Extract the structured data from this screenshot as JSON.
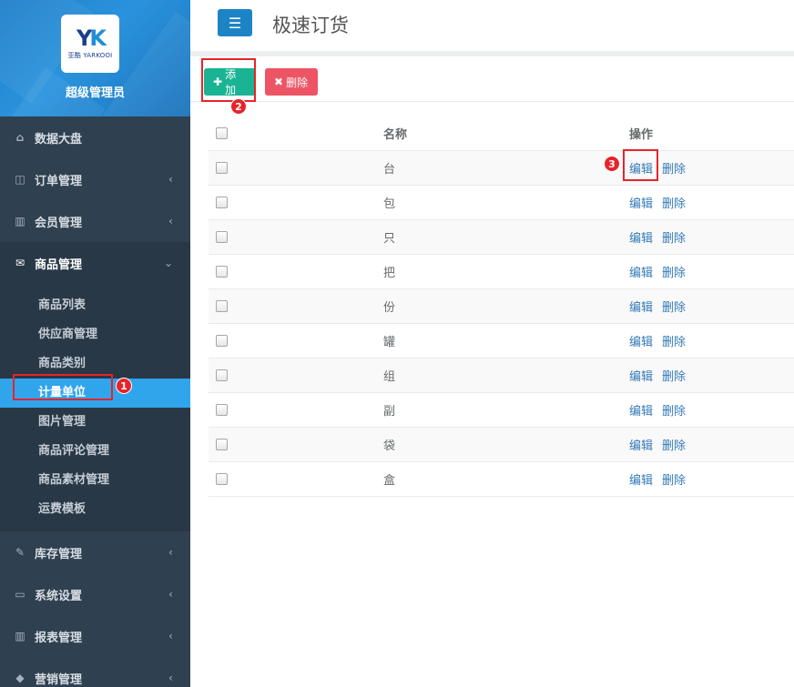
{
  "brand": {
    "logo_mark": "YK",
    "logo_text": "亚酷 YARKOOI",
    "user_role": "超级管理员"
  },
  "sidebar": {
    "menu": [
      {
        "label": "数据大盘",
        "icon": "home-icon",
        "arrow": ""
      },
      {
        "label": "订单管理",
        "icon": "columns-icon",
        "arrow": "‹"
      },
      {
        "label": "会员管理",
        "icon": "bar-chart-icon",
        "arrow": "‹"
      },
      {
        "label": "商品管理",
        "icon": "envelope-icon",
        "arrow": "⌄"
      }
    ],
    "submenu": [
      "商品列表",
      "供应商管理",
      "商品类别",
      "计量单位",
      "图片管理",
      "商品评论管理",
      "商品素材管理",
      "运费模板"
    ],
    "menu_bottom": [
      {
        "label": "库存管理",
        "icon": "edit-icon",
        "arrow": "‹"
      },
      {
        "label": "系统设置",
        "icon": "desktop-icon",
        "arrow": "‹"
      },
      {
        "label": "报表管理",
        "icon": "bar-chart-icon",
        "arrow": "‹"
      },
      {
        "label": "营销管理",
        "icon": "tag-icon",
        "arrow": "‹"
      }
    ]
  },
  "header": {
    "title": "极速订货"
  },
  "toolbar": {
    "add_label": "添加",
    "delete_label": "删除"
  },
  "table": {
    "headers": {
      "name": "名称",
      "actions": "操作"
    },
    "rows": [
      "台",
      "包",
      "只",
      "把",
      "份",
      "罐",
      "组",
      "副",
      "袋",
      "盒"
    ],
    "edit_label": "编辑",
    "delete_label": "删除"
  },
  "annotations": [
    "1",
    "2",
    "3"
  ],
  "colors": {
    "sidebar": "#2f4050",
    "active": "#30a5ec",
    "add": "#1ab394",
    "delete": "#ed5565",
    "highlight": "#e8232a"
  }
}
